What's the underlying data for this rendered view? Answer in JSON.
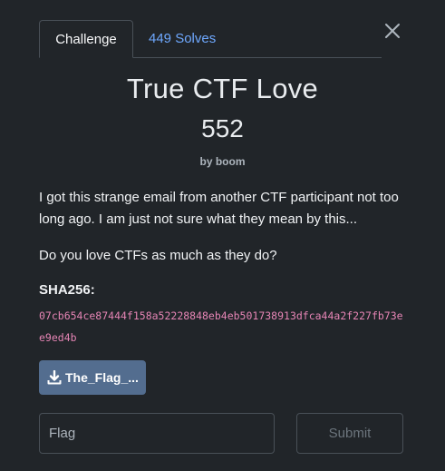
{
  "tabs": {
    "challenge_label": "Challenge",
    "solves_label": "449 Solves"
  },
  "icons": {
    "close": "close-icon",
    "download": "download-icon"
  },
  "challenge": {
    "title": "True CTF Love",
    "points": "552",
    "author_prefix": "by",
    "author_name": "boom",
    "description_1": "I got this strange email from another CTF participant not too long ago. I am just not sure what they mean by this...",
    "description_2": "Do you love CTFs as much as they do?",
    "sha_label": "SHA256:",
    "sha_value": "07cb654ce87444f158a52228848eb4eb501738913dfca44a2f227fb73ee9ed4b"
  },
  "file_button": {
    "label": "The_Flag_..."
  },
  "flag_input": {
    "placeholder": "Flag",
    "value": ""
  },
  "submit": {
    "label": "Submit"
  },
  "colors": {
    "background": "#212529",
    "tab_link": "#6ea8fe",
    "hash": "#e685b5",
    "file_button": "#536d8f"
  }
}
